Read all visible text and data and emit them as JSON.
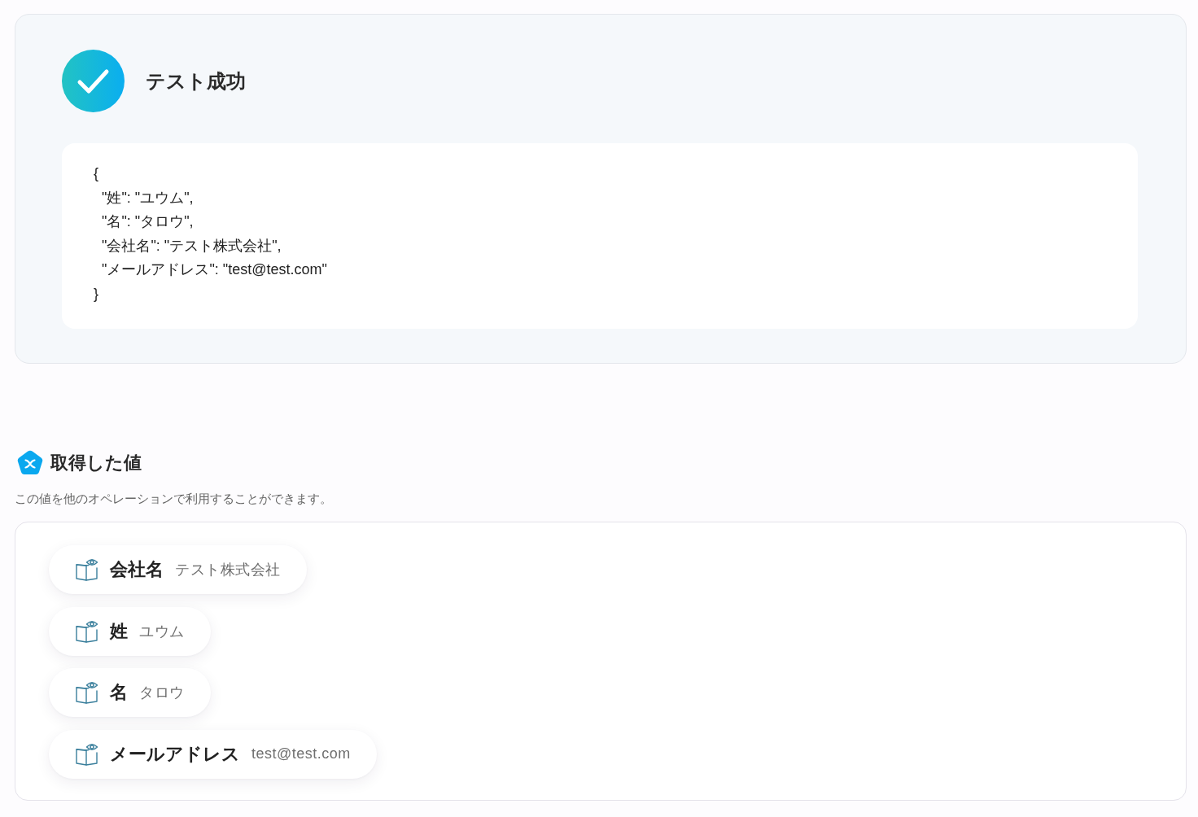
{
  "result": {
    "title": "テスト成功",
    "code_lines": [
      "{",
      "  \"姓\": \"ユウム\",",
      "  \"名\": \"タロウ\",",
      "  \"会社名\": \"テスト株式会社\",",
      "  \"メールアドレス\": \"test@test.com\"",
      "}"
    ]
  },
  "values_section": {
    "title": "取得した値",
    "description": "この値を他のオペレーションで利用することができます。",
    "items": [
      {
        "label": "会社名",
        "value": "テスト株式会社"
      },
      {
        "label": "姓",
        "value": "ユウム"
      },
      {
        "label": "名",
        "value": "タロウ"
      },
      {
        "label": "メールアドレス",
        "value": "test@test.com"
      }
    ]
  }
}
